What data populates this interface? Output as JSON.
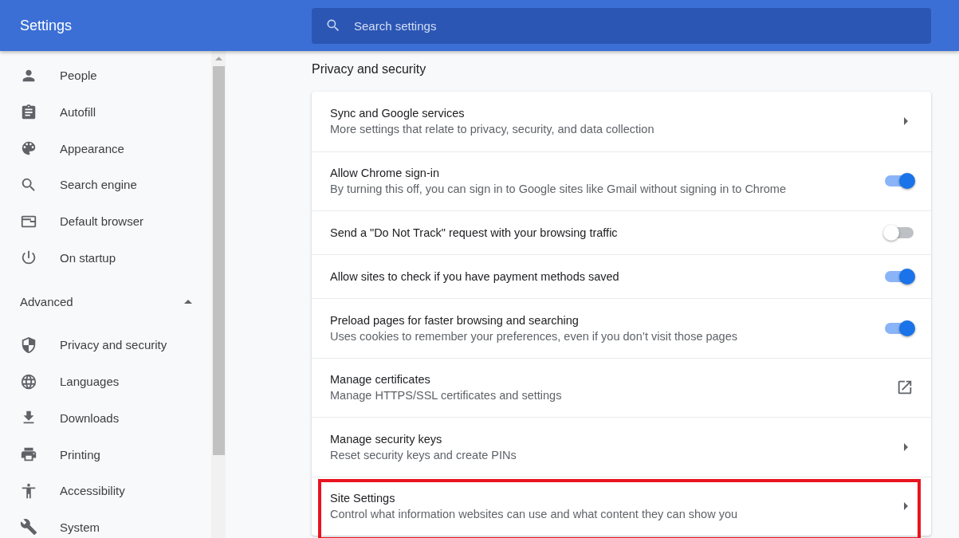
{
  "header": {
    "title": "Settings",
    "search": {
      "placeholder": "Search settings"
    }
  },
  "sidebar": {
    "items": [
      {
        "label": "People",
        "selected": false
      },
      {
        "label": "Autofill",
        "selected": false
      },
      {
        "label": "Appearance",
        "selected": false
      },
      {
        "label": "Search engine",
        "selected": false
      },
      {
        "label": "Default browser",
        "selected": false
      },
      {
        "label": "On startup",
        "selected": false
      }
    ],
    "advanced": {
      "label": "Advanced",
      "expanded": true
    },
    "advanced_items": [
      {
        "label": "Privacy and security",
        "selected": false
      },
      {
        "label": "Languages",
        "selected": false
      },
      {
        "label": "Downloads",
        "selected": false
      },
      {
        "label": "Printing",
        "selected": false
      },
      {
        "label": "Accessibility",
        "selected": false
      },
      {
        "label": "System",
        "selected": false
      }
    ]
  },
  "section": {
    "title": "Privacy and security",
    "rows": [
      {
        "kind": "arrow",
        "title": "Sync and Google services",
        "subtitle": "More settings that relate to privacy, security, and data collection",
        "highlighted": false
      },
      {
        "kind": "toggle",
        "title": "Allow Chrome sign-in",
        "subtitle": "By turning this off, you can sign in to Google sites like Gmail without signing in to Chrome",
        "on": true,
        "highlighted": false
      },
      {
        "kind": "toggle",
        "title": "Send a \"Do Not Track\" request with your browsing traffic",
        "on": false,
        "highlighted": false
      },
      {
        "kind": "toggle",
        "title": "Allow sites to check if you have payment methods saved",
        "on": true,
        "highlighted": false
      },
      {
        "kind": "toggle",
        "title": "Preload pages for faster browsing and searching",
        "subtitle": "Uses cookies to remember your preferences, even if you don’t visit those pages",
        "on": true,
        "highlighted": false
      },
      {
        "kind": "external",
        "title": "Manage certificates",
        "subtitle": "Manage HTTPS/SSL certificates and settings",
        "highlighted": false
      },
      {
        "kind": "arrow",
        "title": "Manage security keys",
        "subtitle": "Reset security keys and create PINs",
        "highlighted": false
      },
      {
        "kind": "arrow",
        "title": "Site Settings",
        "subtitle": "Control what information websites can use and what content they can show you",
        "highlighted": true
      }
    ]
  }
}
